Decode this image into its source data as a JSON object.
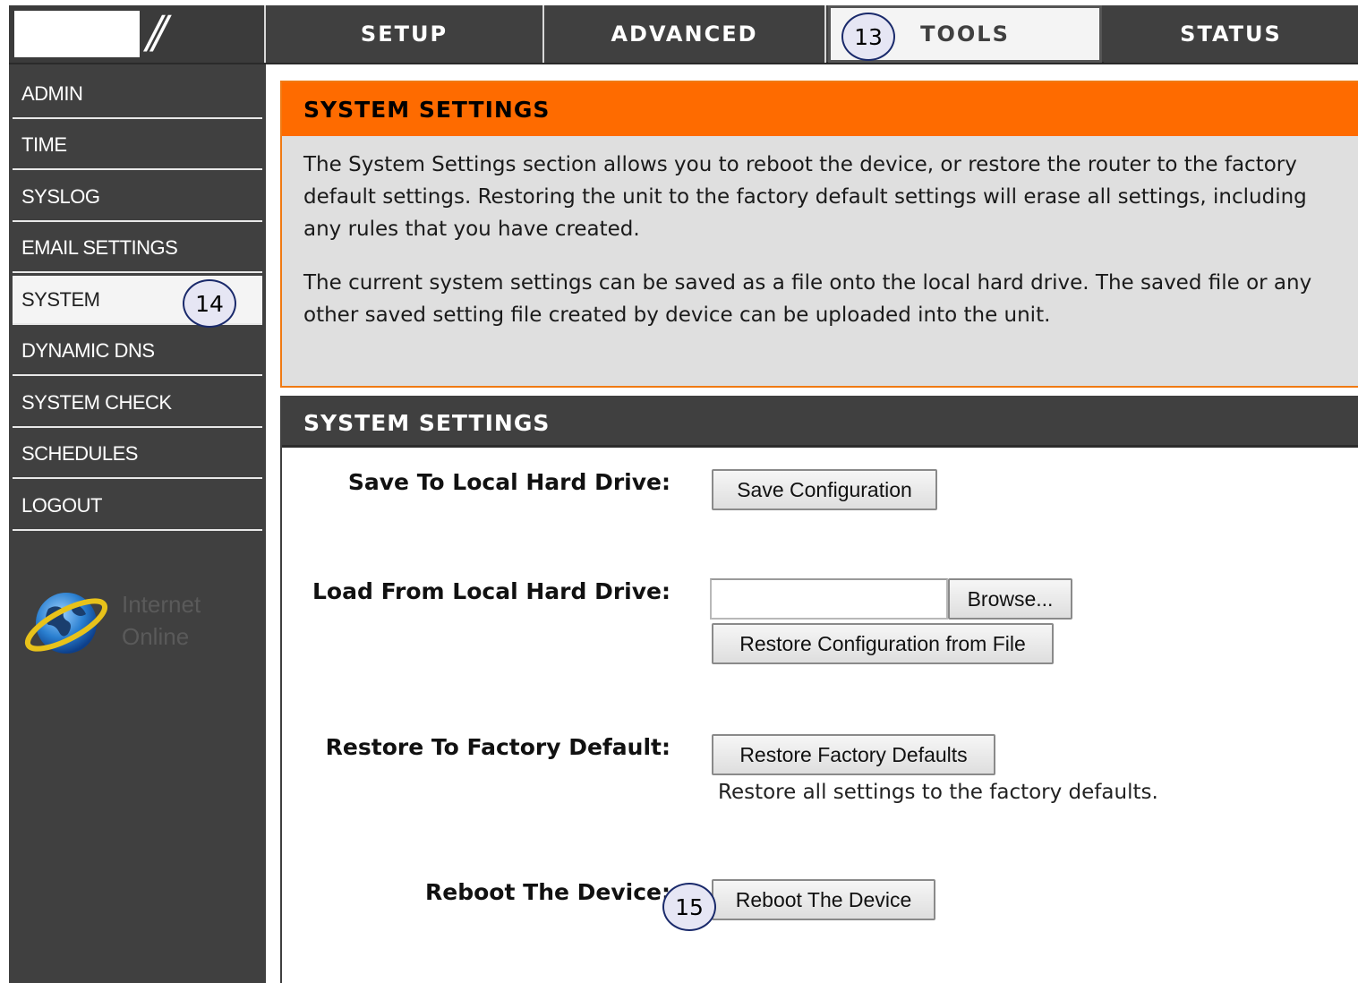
{
  "nav": {
    "tabs": [
      {
        "label": "SETUP"
      },
      {
        "label": "ADVANCED"
      },
      {
        "label": "TOOLS"
      },
      {
        "label": "STATUS"
      }
    ]
  },
  "sidebar": {
    "items": [
      {
        "label": "ADMIN"
      },
      {
        "label": "TIME"
      },
      {
        "label": "SYSLOG"
      },
      {
        "label": "EMAIL SETTINGS"
      },
      {
        "label": "SYSTEM"
      },
      {
        "label": "DYNAMIC DNS"
      },
      {
        "label": "SYSTEM CHECK"
      },
      {
        "label": "SCHEDULES"
      },
      {
        "label": "LOGOUT"
      }
    ],
    "status_line1": "Internet",
    "status_line2": "Online"
  },
  "info": {
    "title": "SYSTEM SETTINGS",
    "paragraph1": "The System Settings section allows you to reboot the device, or restore the router to the factory default settings. Restoring the unit to the factory default settings will erase all settings, including any rules that you have created.",
    "paragraph2": "The current system settings can be saved as a file onto the local hard drive. The saved file or any other saved setting file created by device can be uploaded into the unit."
  },
  "settings": {
    "title": "SYSTEM SETTINGS",
    "save_label": "Save To Local Hard Drive:",
    "save_button": "Save Configuration",
    "load_label": "Load From Local Hard Drive:",
    "browse_button": "Browse...",
    "restore_file_button": "Restore Configuration from File",
    "factory_label": "Restore To Factory Default:",
    "factory_button": "Restore Factory Defaults",
    "factory_hint": "Restore all settings to the factory defaults.",
    "reboot_label": "Reboot The Device:",
    "reboot_button": "Reboot The Device"
  },
  "callouts": {
    "tools": "13",
    "system": "14",
    "reboot": "15"
  },
  "colors": {
    "nav_bg": "#404040",
    "accent_orange": "#fe6b00",
    "info_bg": "#dfdfdf",
    "callout_bg": "#e6e6f4"
  }
}
